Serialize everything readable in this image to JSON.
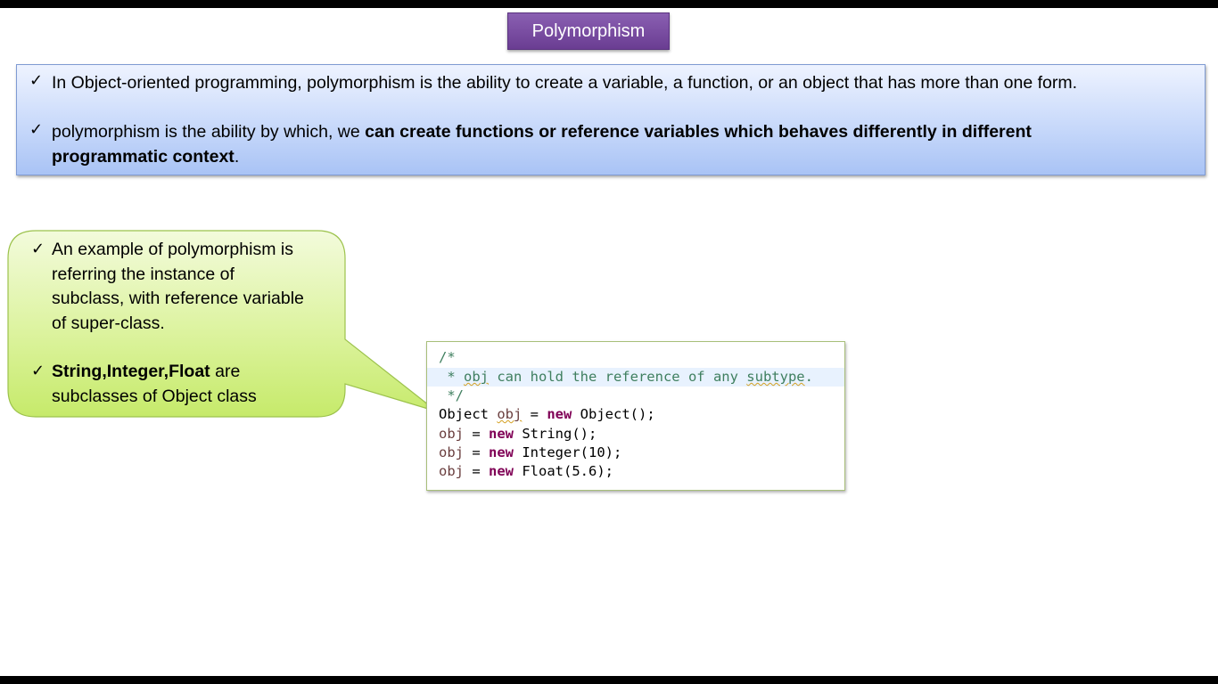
{
  "title": "Polymorphism",
  "top_bullets": [
    {
      "plain": "In Object-oriented programming, polymorphism is the ability to create a variable, a function, or an object that has more than one form."
    },
    {
      "prefix": "polymorphism is the ability by which, we ",
      "bold_line1": "can create functions or reference variables which behaves differently in different",
      "bold_line2": "programmatic context",
      "suffix": "."
    }
  ],
  "callout": {
    "bullet1": [
      "An example of polymorphism is",
      "referring the instance of",
      "subclass, with reference variable",
      "of super-class."
    ],
    "bullet2_bold": "String,Integer,Float",
    "bullet2_rest1": " are",
    "bullet2_rest2": "subclasses of Object class"
  },
  "code": {
    "comment_open": "/*",
    "comment_star": " * ",
    "comment_obj": "obj",
    "comment_mid": " can hold the reference of any ",
    "comment_subtype": "subtype",
    "comment_end": ".",
    "comment_close": " */",
    "line1_type": "Object ",
    "line1_var": "obj",
    "line1_eq": " = ",
    "line1_kw": "new",
    "line1_rest": " Object();",
    "line2_var": "obj",
    "line2_eq": " = ",
    "line2_kw": "new",
    "line2_rest": " String();",
    "line3_var": "obj",
    "line3_eq": " = ",
    "line3_kw": "new",
    "line3_rest": " Integer(10);",
    "line4_var": "obj",
    "line4_eq": " = ",
    "line4_kw": "new",
    "line4_rest": " Float(5.6);"
  },
  "icons": {
    "check": "✓"
  },
  "colors": {
    "title_bg": "#7a4fa3",
    "blue_box": "#c5d7fa",
    "callout_green": "#d4f28c",
    "code_comment": "#3f7f5f",
    "code_keyword": "#7f0055"
  }
}
